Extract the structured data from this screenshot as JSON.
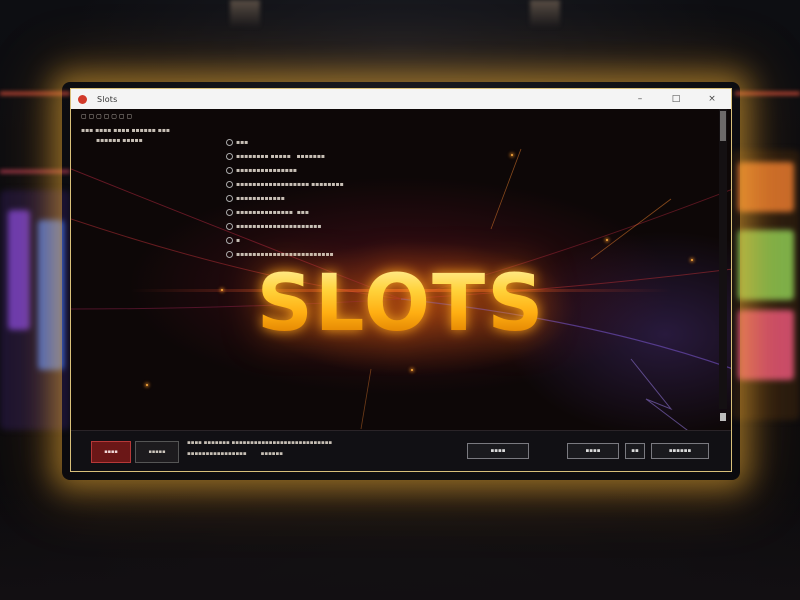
{
  "window": {
    "title": "Slots",
    "controls": {
      "minimize": "–",
      "maximize": "□",
      "close": "×"
    }
  },
  "content": {
    "headline": "SLOTS"
  },
  "colors": {
    "accent_gold": "#ffd23a",
    "glow_orange": "#ff8a1a",
    "titlebar_bg": "#f4f4f4",
    "content_bg": "#0d0707"
  },
  "icons": {
    "app": "app-icon",
    "minimize": "minimize-icon",
    "maximize": "maximize-icon",
    "close": "close-icon"
  }
}
